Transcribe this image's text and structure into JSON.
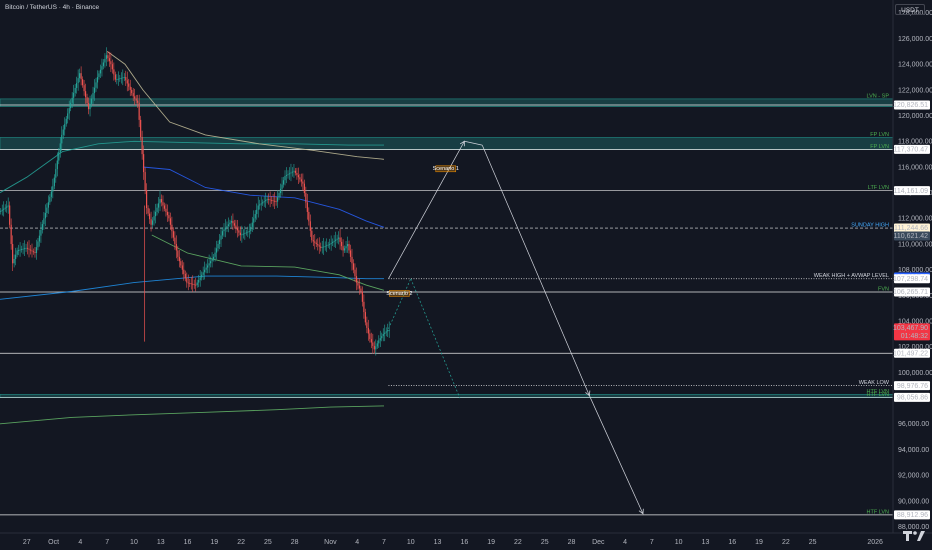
{
  "header": {
    "symbol": "Bitcoin / TetherUS · 4h · Binance",
    "currency": "USDT"
  },
  "chart_data": {
    "type": "candlestick",
    "title": "Bitcoin / TetherUS · 4h · Binance",
    "ylim": [
      87500,
      129000
    ],
    "xlim": [
      -3,
      97
    ],
    "y_ticks": [
      128000,
      126000,
      124000,
      122000,
      120000,
      118000,
      116000,
      114000,
      112000,
      110000,
      108000,
      106000,
      104000,
      102000,
      100000,
      98000,
      96000,
      94000,
      92000,
      90000,
      88000
    ],
    "y_tick_labels": [
      "128,000.00",
      "126,000.00",
      "124,000.00",
      "122,000.00",
      "120,000.00",
      "118,000.00",
      "116,000.00",
      "114,000.00",
      "112,000.00",
      "110,000.00",
      "108,000.00",
      "106,000.00",
      "104,000.00",
      "102,000.00",
      "100,000.00",
      "98,000.00",
      "96,000.00",
      "94,000.00",
      "92,000.00",
      "90,000.00",
      "88,000.00"
    ],
    "x_ticks": [
      {
        "label": "27",
        "d": 0
      },
      {
        "label": "Oct",
        "d": 3
      },
      {
        "label": "4",
        "d": 6
      },
      {
        "label": "7",
        "d": 9
      },
      {
        "label": "10",
        "d": 12
      },
      {
        "label": "13",
        "d": 15
      },
      {
        "label": "16",
        "d": 18
      },
      {
        "label": "19",
        "d": 21
      },
      {
        "label": "22",
        "d": 24
      },
      {
        "label": "25",
        "d": 27
      },
      {
        "label": "28",
        "d": 30
      },
      {
        "label": "Nov",
        "d": 34
      },
      {
        "label": "4",
        "d": 37
      },
      {
        "label": "7",
        "d": 40
      },
      {
        "label": "10",
        "d": 43
      },
      {
        "label": "13",
        "d": 46
      },
      {
        "label": "16",
        "d": 49
      },
      {
        "label": "19",
        "d": 52
      },
      {
        "label": "22",
        "d": 55
      },
      {
        "label": "25",
        "d": 58
      },
      {
        "label": "28",
        "d": 61
      },
      {
        "label": "Dec",
        "d": 64
      },
      {
        "label": "4",
        "d": 67
      },
      {
        "label": "7",
        "d": 70
      },
      {
        "label": "10",
        "d": 73
      },
      {
        "label": "13",
        "d": 76
      },
      {
        "label": "16",
        "d": 79
      },
      {
        "label": "19",
        "d": 82
      },
      {
        "label": "22",
        "d": 85
      },
      {
        "label": "25",
        "d": 88
      },
      {
        "label": "2026",
        "d": 95
      }
    ],
    "price_path": [
      [
        -3,
        112500
      ],
      [
        -2,
        113000
      ],
      [
        -1.5,
        108500
      ],
      [
        -1,
        109500
      ],
      [
        0,
        109700
      ],
      [
        1,
        109300
      ],
      [
        2,
        112000
      ],
      [
        3,
        114500
      ],
      [
        4,
        118500
      ],
      [
        5,
        121000
      ],
      [
        6,
        123300
      ],
      [
        7,
        120500
      ],
      [
        8,
        123000
      ],
      [
        9,
        124700
      ],
      [
        9.5,
        124000
      ],
      [
        10,
        122800
      ],
      [
        11,
        123000
      ],
      [
        12,
        121500
      ],
      [
        12.5,
        121000
      ],
      [
        13,
        117000
      ],
      [
        13.5,
        112800
      ],
      [
        14,
        111500
      ],
      [
        15,
        113500
      ],
      [
        16,
        112000
      ],
      [
        17,
        109000
      ],
      [
        18,
        107000
      ],
      [
        19,
        106800
      ],
      [
        20,
        108000
      ],
      [
        21,
        109000
      ],
      [
        22,
        111000
      ],
      [
        23,
        111800
      ],
      [
        24,
        110700
      ],
      [
        25,
        111000
      ],
      [
        26,
        113000
      ],
      [
        27,
        113500
      ],
      [
        28,
        113300
      ],
      [
        29,
        115300
      ],
      [
        30,
        115700
      ],
      [
        31,
        114700
      ],
      [
        32,
        110300
      ],
      [
        33,
        109700
      ],
      [
        34,
        110000
      ],
      [
        35,
        110500
      ],
      [
        35.5,
        109500
      ],
      [
        36,
        110000
      ],
      [
        37,
        107000
      ],
      [
        37.5,
        106300
      ],
      [
        38,
        103900
      ],
      [
        38.5,
        102600
      ],
      [
        39,
        101800
      ],
      [
        39.5,
        102500
      ],
      [
        40,
        103000
      ],
      [
        40.5,
        103300
      ]
    ],
    "series": [
      {
        "name": "",
        "color": "#26a69a",
        "values": [
          [
            -3,
            114000
          ],
          [
            0,
            115200
          ],
          [
            4,
            117200
          ],
          [
            8,
            117800
          ],
          [
            12,
            118000
          ],
          [
            18,
            117900
          ],
          [
            24,
            117800
          ],
          [
            30,
            117800
          ],
          [
            36,
            117700
          ],
          [
            40,
            117700
          ]
        ]
      },
      {
        "name": "",
        "color": "#c7c19b",
        "values": [
          [
            9,
            125000
          ],
          [
            11,
            124000
          ],
          [
            13,
            122000
          ],
          [
            16,
            119500
          ],
          [
            20,
            118500
          ],
          [
            26,
            117800
          ],
          [
            32,
            117300
          ],
          [
            37,
            116800
          ],
          [
            40,
            116600
          ]
        ]
      },
      {
        "name": "",
        "color": "#2962ff",
        "values": [
          [
            13,
            116000
          ],
          [
            16,
            115800
          ],
          [
            20,
            114400
          ],
          [
            25,
            113800
          ],
          [
            30,
            113600
          ],
          [
            35,
            112700
          ],
          [
            38,
            111800
          ],
          [
            40,
            111300
          ]
        ]
      },
      {
        "name": "",
        "color": "#2196f3",
        "values": [
          [
            -3,
            105700
          ],
          [
            5,
            106300
          ],
          [
            12,
            107000
          ],
          [
            20,
            107500
          ],
          [
            28,
            107500
          ],
          [
            34,
            107400
          ],
          [
            38,
            107300
          ],
          [
            40,
            107300
          ]
        ]
      },
      {
        "name": "",
        "color": "#66bb6a",
        "values": [
          [
            14,
            110700
          ],
          [
            18,
            109300
          ],
          [
            24,
            108300
          ],
          [
            30,
            108200
          ],
          [
            35,
            107600
          ],
          [
            38,
            106800
          ],
          [
            40,
            106400
          ]
        ]
      },
      {
        "name": "",
        "color": "#66bb6a",
        "values": [
          [
            -3,
            96000
          ],
          [
            5,
            96500
          ],
          [
            12,
            96700
          ],
          [
            20,
            96900
          ],
          [
            28,
            97100
          ],
          [
            34,
            97300
          ],
          [
            40,
            97400
          ]
        ]
      }
    ],
    "zones": [
      {
        "name": "LVN - SP",
        "y1": 120700,
        "y2": 121300,
        "color": "#26a69a"
      },
      {
        "name": "FP LVN",
        "y1": 117370,
        "y2": 118300,
        "color": "#26a69a"
      },
      {
        "name": "HTF LVN",
        "y1": 98050,
        "y2": 98300,
        "color": "#26a69a"
      }
    ],
    "levels": [
      {
        "label": "",
        "price": 120826.51,
        "price_label": "120,826.51",
        "style": "solid",
        "color": "#ffffff"
      },
      {
        "label": "FP LVN",
        "price": 117370.47,
        "price_label": "117,370.47",
        "style": "solid",
        "color": "#ffffff"
      },
      {
        "label": "LTF LVN",
        "price": 114161.09,
        "price_label": "114,161.09",
        "style": "solid",
        "color": "#ffffff"
      },
      {
        "label": "SUNDAY HIGH",
        "price": 111244.66,
        "price_label": "111,244.66",
        "style": "dashed",
        "color": "#ffffff"
      },
      {
        "label": "",
        "price": 110621.42,
        "price_label": "110,621.42",
        "style": "none",
        "color": "#3a4a5c"
      },
      {
        "label": "",
        "price": 107429.75,
        "price_label": "107,429.75",
        "style": "none",
        "color": "#2962ff"
      },
      {
        "label": "WEAK HIGH + AVWAP LEVEL",
        "price": 107298.74,
        "price_label": "107,298.74",
        "style": "dotted",
        "color": "#ffffff"
      },
      {
        "label": "FVN",
        "price": 106265.71,
        "price_label": "106,265.71",
        "style": "solid",
        "color": "#ffffff"
      },
      {
        "label": "",
        "price": 103467.9,
        "price_label": "103,467.90",
        "style": "none",
        "color": "#f23645"
      },
      {
        "label": "",
        "price": 101497.22,
        "price_label": "101,497.22",
        "style": "solid",
        "color": "#ffffff"
      },
      {
        "label": "WEAK LOW",
        "price": 98976.76,
        "price_label": "98,976.76",
        "style": "dotted",
        "color": "#ffffff"
      },
      {
        "label": "HTF LVN",
        "price": 98056.86,
        "price_label": "98,056.86",
        "style": "solid",
        "color": "#ffffff"
      },
      {
        "label": "HTF LVN",
        "price": 88912.96,
        "price_label": "88,912.96",
        "style": "solid",
        "color": "#ffffff"
      }
    ],
    "countdown": "01:48:32",
    "scenarios": [
      {
        "label": "Scenario 1",
        "path": [
          [
            40.5,
            107300
          ],
          [
            49,
            118000
          ],
          [
            51,
            117700
          ],
          [
            63,
            98200
          ],
          [
            69,
            89000
          ]
        ],
        "style": "solid"
      },
      {
        "label": "Scenario 2",
        "path": [
          [
            40.5,
            103400
          ],
          [
            43,
            107300
          ],
          [
            48.5,
            98000
          ]
        ],
        "style": "dashed"
      }
    ],
    "colors": {
      "background": "#131722",
      "up": "#26a69a",
      "down": "#ef5350",
      "last_price": "#f23645",
      "zone_label": "#4caf50"
    }
  }
}
